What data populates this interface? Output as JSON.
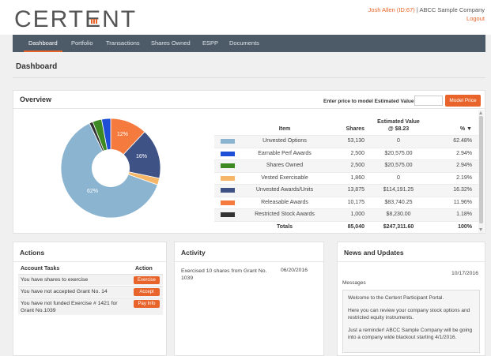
{
  "header": {
    "logo_text": "CERTENT",
    "user_name": "Josh Allen (ID:67)",
    "company": " | ABCC Sample Company",
    "logout": "Logout"
  },
  "nav": {
    "tabs": [
      {
        "label": "Dashboard",
        "active": true
      },
      {
        "label": "Portfolio",
        "active": false
      },
      {
        "label": "Transactions",
        "active": false
      },
      {
        "label": "Shares Owned",
        "active": false
      },
      {
        "label": "ESPP",
        "active": false
      },
      {
        "label": "Documents",
        "active": false
      }
    ]
  },
  "page_title": "Dashboard",
  "overview": {
    "title": "Overview",
    "model_label": "Enter price to model Estimated Value below:",
    "model_input_value": "",
    "model_button": "Model Price",
    "columns": {
      "item": "Item",
      "shares": "Shares",
      "est_value_line1": "Estimated Value",
      "est_value_line2": "@ $8.23",
      "pct": "% ▼"
    },
    "rows": [
      {
        "color": "#8ab4d0",
        "item": "Unvested Options",
        "shares": "53,130",
        "value": "0",
        "pct": "62.48%"
      },
      {
        "color": "#1f4fd6",
        "item": "Earnable Perf Awards",
        "shares": "2,500",
        "value": "$20,575.00",
        "pct": "2.94%"
      },
      {
        "color": "#3d8a22",
        "item": "Shares Owned",
        "shares": "2,500",
        "value": "$20,575.00",
        "pct": "2.94%"
      },
      {
        "color": "#f6b668",
        "item": "Vested Exercisable",
        "shares": "1,860",
        "value": "0",
        "pct": "2.19%"
      },
      {
        "color": "#3f5286",
        "item": "Unvested Awards/Units",
        "shares": "13,875",
        "value": "$114,191.25",
        "pct": "16.32%"
      },
      {
        "color": "#f57a3d",
        "item": "Releasable Awards",
        "shares": "10,175",
        "value": "$83,740.25",
        "pct": "11.96%"
      },
      {
        "color": "#333333",
        "item": "Restricted Stock Awards",
        "shares": "1,000",
        "value": "$8,230.00",
        "pct": "1.18%"
      }
    ],
    "total": {
      "item": "Totals",
      "shares": "85,040",
      "value": "$247,311.60",
      "pct": "100%"
    },
    "pie_labels": {
      "a": "62%",
      "b": "16%",
      "c": "12%"
    }
  },
  "chart_data": {
    "type": "pie",
    "categories": [
      "Unvested Options",
      "Earnable Perf Awards",
      "Shares Owned",
      "Vested Exercisable",
      "Unvested Awards/Units",
      "Releasable Awards",
      "Restricted Stock Awards"
    ],
    "values": [
      62.48,
      2.94,
      2.94,
      2.19,
      16.32,
      11.96,
      1.18
    ],
    "colors": [
      "#8ab4d0",
      "#1f4fd6",
      "#3d8a22",
      "#f6b668",
      "#3f5286",
      "#f57a3d",
      "#333333"
    ],
    "donut": true
  },
  "actions": {
    "title": "Actions",
    "head_tasks": "Account Tasks",
    "head_action": "Action",
    "rows": [
      {
        "text": "You have shares to exercise",
        "button": "Exercise"
      },
      {
        "text": "You have not accepted Grant No. 14",
        "button": "Accept"
      },
      {
        "text": "You have not funded Exercise # 1421 for Grant No.1039",
        "button": "Pay Info"
      }
    ]
  },
  "activity": {
    "title": "Activity",
    "items": [
      {
        "text": "Exercised 10 shares from Grant No. 1039",
        "date": "06/20/2016"
      }
    ]
  },
  "news": {
    "title": "News and Updates",
    "date": "10/17/2016",
    "messages_label": "Messages",
    "messages": [
      "Welcome to the Certent Participant Portal.",
      "Here you can review your company stock options and restricted equity instruments.",
      "Just a reminder! ABCC Sample Company will be going into a company wide blackout starting 4/1/2016."
    ]
  }
}
